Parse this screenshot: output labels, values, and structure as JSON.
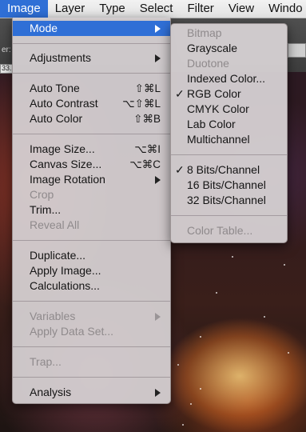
{
  "menubar": {
    "items": [
      "Image",
      "Layer",
      "Type",
      "Select",
      "Filter",
      "View",
      "Windo"
    ],
    "active": "Image"
  },
  "toolbar": {
    "left_fragment": "er:",
    "zoom_fragment": "33."
  },
  "image_menu": {
    "items": [
      {
        "label": "Mode",
        "submenu": true,
        "highlight": true
      },
      {
        "label": "Adjustments",
        "submenu": true
      },
      {
        "label": "Auto Tone",
        "shortcut": "⇧⌘L"
      },
      {
        "label": "Auto Contrast",
        "shortcut": "⌥⇧⌘L"
      },
      {
        "label": "Auto Color",
        "shortcut": "⇧⌘B"
      },
      {
        "label": "Image Size...",
        "shortcut": "⌥⌘I"
      },
      {
        "label": "Canvas Size...",
        "shortcut": "⌥⌘C"
      },
      {
        "label": "Image Rotation",
        "submenu": true
      },
      {
        "label": "Crop",
        "disabled": true
      },
      {
        "label": "Trim..."
      },
      {
        "label": "Reveal All",
        "disabled": true
      },
      {
        "label": "Duplicate..."
      },
      {
        "label": "Apply Image..."
      },
      {
        "label": "Calculations..."
      },
      {
        "label": "Variables",
        "submenu": true,
        "disabled": true
      },
      {
        "label": "Apply Data Set...",
        "disabled": true
      },
      {
        "label": "Trap...",
        "disabled": true
      },
      {
        "label": "Analysis",
        "submenu": true
      }
    ]
  },
  "mode_submenu": {
    "items": [
      {
        "label": "Bitmap",
        "disabled": true
      },
      {
        "label": "Grayscale"
      },
      {
        "label": "Duotone",
        "disabled": true
      },
      {
        "label": "Indexed Color..."
      },
      {
        "label": "RGB Color",
        "checked": true
      },
      {
        "label": "CMYK Color"
      },
      {
        "label": "Lab Color"
      },
      {
        "label": "Multichannel"
      },
      {
        "label": "8 Bits/Channel",
        "checked": true
      },
      {
        "label": "16 Bits/Channel"
      },
      {
        "label": "32 Bits/Channel"
      },
      {
        "label": "Color Table...",
        "disabled": true
      }
    ],
    "check_glyph": "✓"
  },
  "colors": {
    "highlight": "#2f6fd6"
  }
}
